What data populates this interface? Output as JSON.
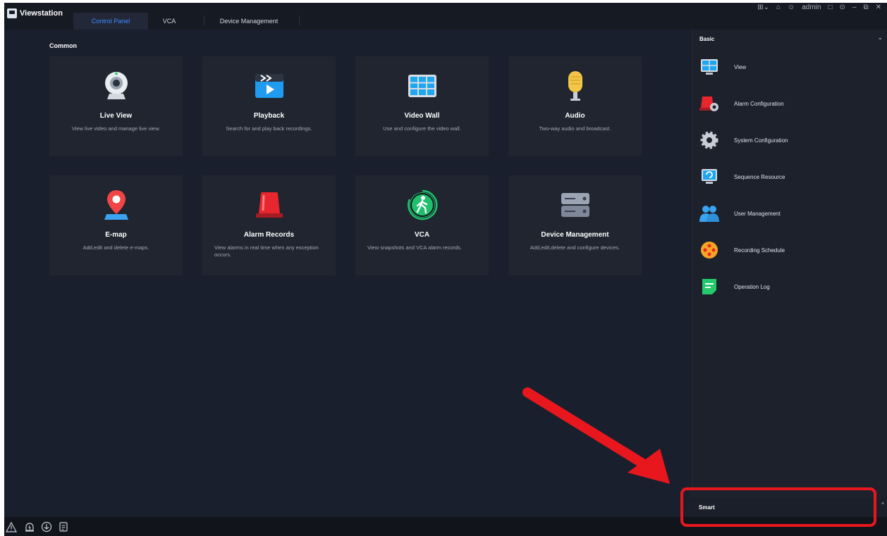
{
  "app": {
    "title": "Viewstation"
  },
  "tabs": [
    {
      "label": "Control Panel",
      "active": true
    },
    {
      "label": "VCA",
      "active": false
    },
    {
      "label": "Device Management",
      "active": false
    }
  ],
  "window": {
    "user": "admin"
  },
  "main": {
    "section_title": "Common",
    "cards": [
      {
        "title": "Live View",
        "desc": "View live video and manage live view.",
        "icon": "camera-icon"
      },
      {
        "title": "Playback",
        "desc": "Search for and play back recordings.",
        "icon": "playback-icon"
      },
      {
        "title": "Video Wall",
        "desc": "Use and configure the video wall.",
        "icon": "video-wall-icon"
      },
      {
        "title": "Audio",
        "desc": "Two-way audio and broadcast.",
        "icon": "microphone-icon"
      },
      {
        "title": "E-map",
        "desc": "Add,edit and delete e-maps.",
        "icon": "map-pin-icon"
      },
      {
        "title": "Alarm Records",
        "desc": "View alarms in real time when any exception occurs.",
        "icon": "alarm-light-icon"
      },
      {
        "title": "VCA",
        "desc": "View snapshots and VCA alarm records.",
        "icon": "pedestrian-icon"
      },
      {
        "title": "Device Management",
        "desc": "Add,edit,delete and configure devices.",
        "icon": "server-icon"
      }
    ]
  },
  "right_panel": {
    "header": "Basic",
    "items": [
      {
        "label": "View",
        "icon": "monitor-icon"
      },
      {
        "label": "Alarm Configuration",
        "icon": "alarm-config-icon"
      },
      {
        "label": "System Configuration",
        "icon": "gear-icon"
      },
      {
        "label": "Sequence Resource",
        "icon": "sequence-icon"
      },
      {
        "label": "User Management",
        "icon": "users-icon"
      },
      {
        "label": "Recording Schedule",
        "icon": "recording-schedule-icon"
      },
      {
        "label": "Operation Log",
        "icon": "log-icon"
      }
    ],
    "smart_label": "Smart"
  },
  "colors": {
    "accent": "#3d8bff",
    "annotation": "#e8171d",
    "background": "#1a1f2d"
  }
}
